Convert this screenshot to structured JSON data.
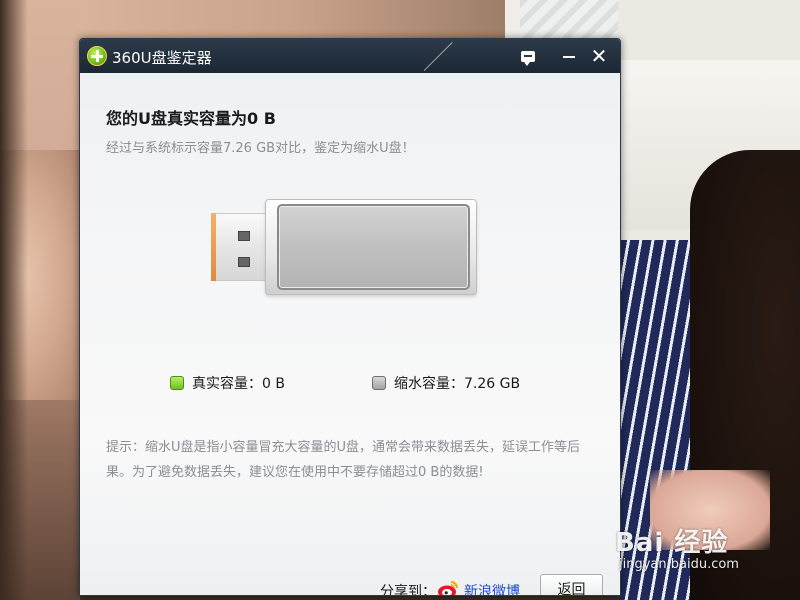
{
  "window": {
    "title": "360U盘鉴定器",
    "icon": "360-logo-icon"
  },
  "titlebar_buttons": {
    "feedback_icon": "feedback-icon",
    "minimize_icon": "minimize-icon",
    "close_icon": "close-icon",
    "close_glyph": "✕"
  },
  "result": {
    "heading": "您的U盘真实容量为0 B",
    "subheading": "经过与系统标示容量7.26 GB对比，鉴定为缩水U盘！",
    "real_capacity_fraction": 0
  },
  "legend": {
    "real": {
      "label": "真实容量：0 B",
      "color": "#6ec11f"
    },
    "shrink": {
      "label": "缩水容量：7.26 GB",
      "color": "#a4a4a4"
    }
  },
  "hint": {
    "text": "提示：缩水U盘是指小容量冒充大容量的U盘，通常会带来数据丢失，延误工作等后果。为了避免数据丢失，建议您在使用中不要存储超过0 B的数据!"
  },
  "footer": {
    "share_label": "分享到：",
    "weibo_icon": "weibo-icon",
    "weibo_label": "新浪微博",
    "back_label": "返回"
  },
  "watermark": {
    "main": "Bai 经验",
    "sub": "jingyan.baidu.com"
  },
  "colors": {
    "titlebar": "#1b2733",
    "link": "#1a4fd0",
    "muted_text": "#8a8f94",
    "real_capacity": "#6ec11f",
    "shrink_capacity": "#a4a4a4"
  }
}
